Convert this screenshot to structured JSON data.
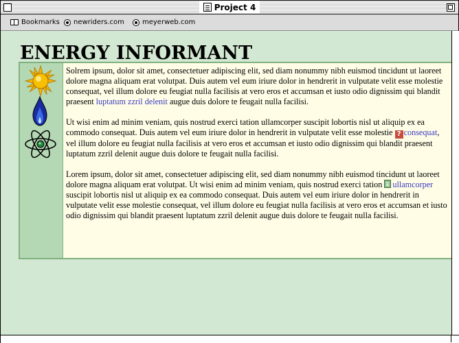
{
  "window": {
    "title": "Project 4"
  },
  "bookmarks": {
    "items": [
      {
        "label": "Bookmarks",
        "icon": "book-icon"
      },
      {
        "label": "newriders.com",
        "icon": "globe-icon"
      },
      {
        "label": "meyerweb.com",
        "icon": "globe-icon"
      }
    ]
  },
  "page": {
    "title": "ENERGY INFORMANT",
    "icons": [
      "sun-icon",
      "flame-icon",
      "atom-icon"
    ],
    "paragraphs": [
      {
        "before": "Solrem ipsum, dolor sit amet, consectetuer adipiscing elit, sed diam nonummy nibh euismod tincidunt ut laoreet dolore magna aliquam erat volutpat. Duis autem vel eum iriure dolor in hendrerit in vulputate velit esse molestie consequat, vel illum dolore eu feugiat nulla facilisis at vero eros et accumsan et iusto odio dignissim qui blandit praesent ",
        "link": "luptatum zzril delenit",
        "after": " augue duis dolore te feugait nulla facilisi."
      },
      {
        "before": "Ut wisi enim ad minim veniam, quis nostrud exerci tation ullamcorper suscipit lobortis nisl ut aliquip ex ea commodo consequat. Duis autem vel eum iriure dolor in hendrerit in vulputate velit esse molestie ",
        "link_icon": "question-icon",
        "link": "consequat",
        "after": ", vel illum dolore eu feugiat nulla facilisis at vero eros et accumsan et iusto odio dignissim qui blandit praesent luptatum zzril delenit augue duis dolore te feugait nulla facilisi."
      },
      {
        "before": "Lorem ipsum, dolor sit amet, consectetuer adipiscing elit, sed diam nonummy nibh euismod tincidunt ut laoreet dolore magna aliquam erat volutpat. Ut wisi enim ad minim veniam, quis nostrud exerci tation ",
        "link_icon": "document-icon",
        "link": "ullamcorper",
        "after": " suscipit lobortis nisl ut aliquip ex ea commodo consequat. Duis autem vel eum iriure dolor in hendrerit in vulputate velit esse molestie consequat, vel illum dolore eu feugiat nulla facilisis at vero eros et accumsan et iusto odio dignissim qui blandit praesent luptatum zzril delenit augue duis dolore te feugait nulla facilisi."
      }
    ]
  },
  "colors": {
    "page_background": "#d2e8d2",
    "box_background": "#fffde6",
    "icon_column": "#b4d8b4",
    "border": "#7fb07f",
    "link": "#3a3ac0"
  }
}
